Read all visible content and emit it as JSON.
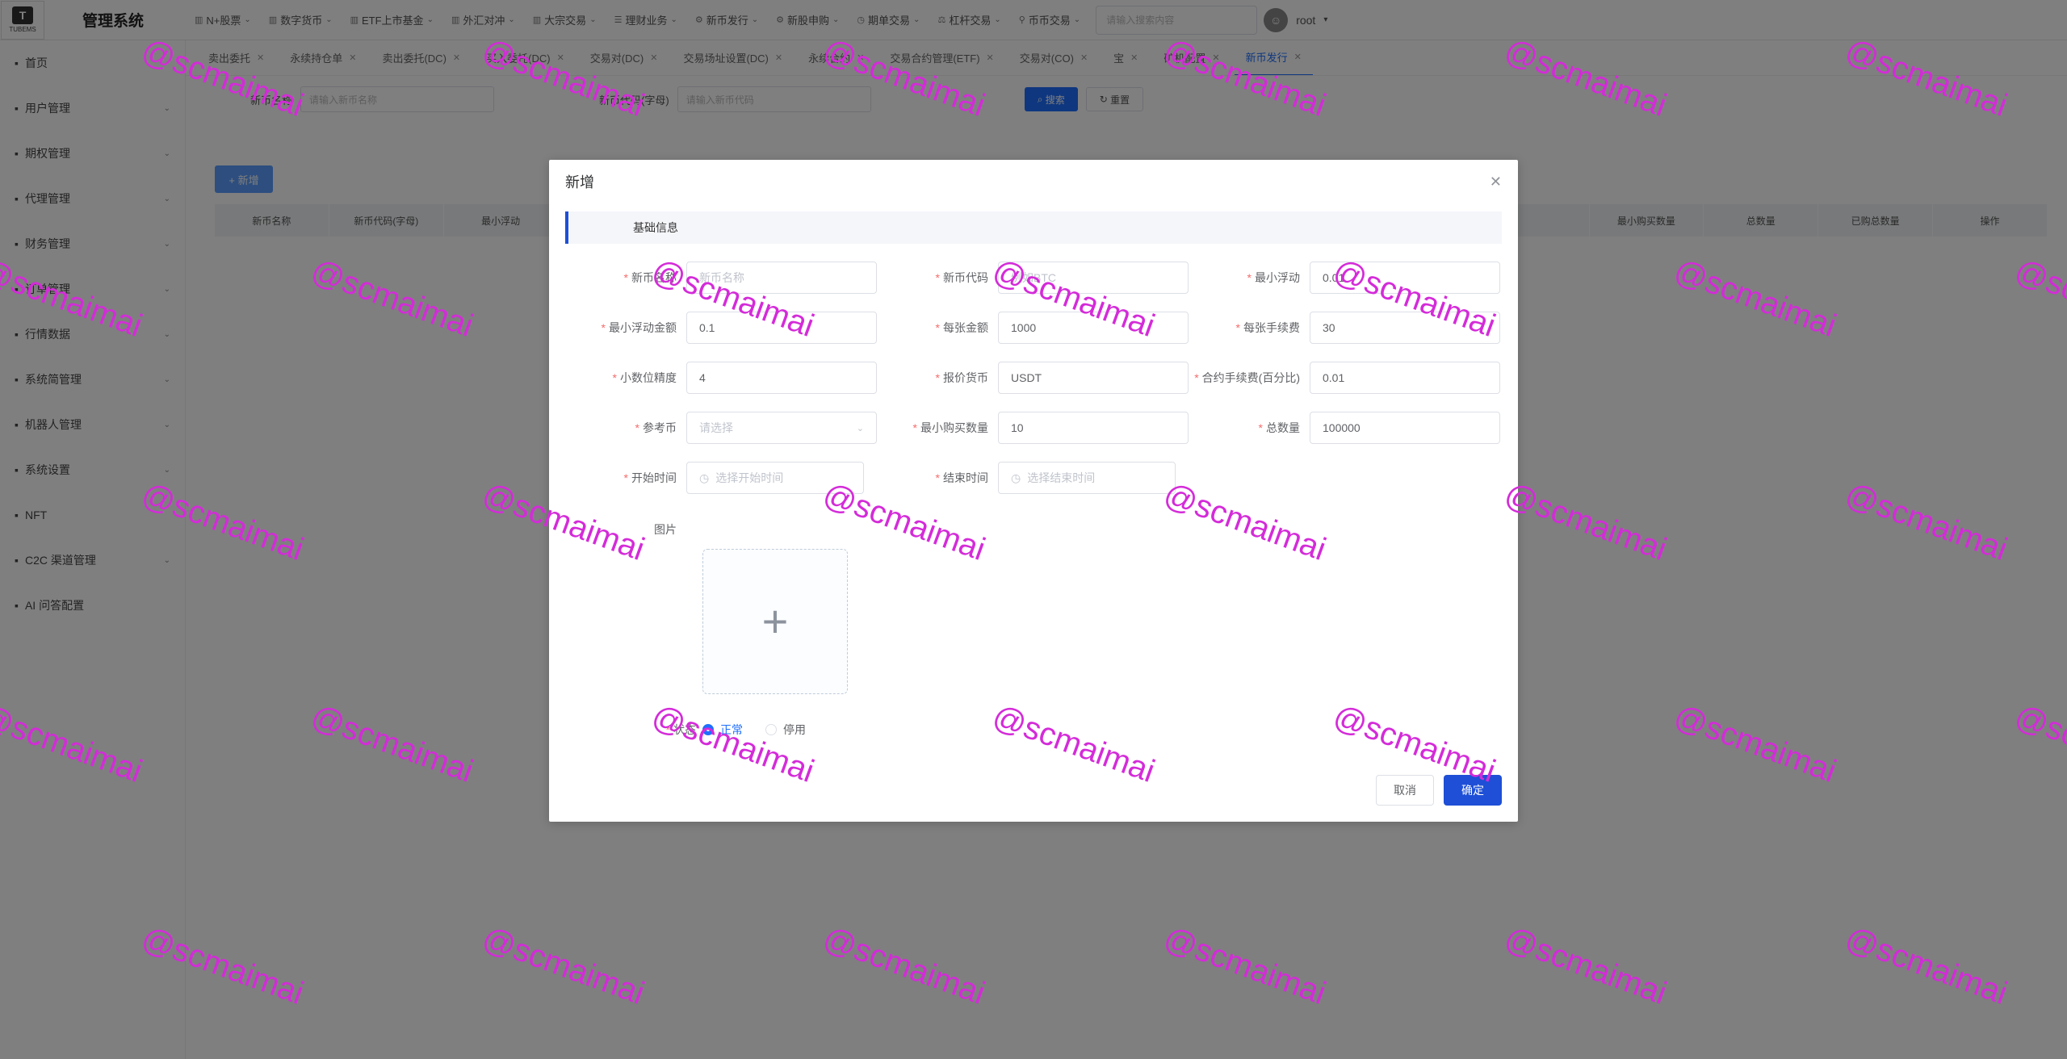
{
  "app": {
    "logo_text": "TUBEMS",
    "title": "管理系统"
  },
  "topnav": [
    {
      "label": "N+股票",
      "icon": "chart-icon"
    },
    {
      "label": "数字货币",
      "icon": "chart-icon"
    },
    {
      "label": "ETF上市基金",
      "icon": "chart-icon"
    },
    {
      "label": "外汇对冲",
      "icon": "chart-icon"
    },
    {
      "label": "大宗交易",
      "icon": "chart-icon"
    },
    {
      "label": "理财业务",
      "icon": "list-icon"
    },
    {
      "label": "新币发行",
      "icon": "gear-icon"
    },
    {
      "label": "新股申购",
      "icon": "gear-icon"
    },
    {
      "label": "期单交易",
      "icon": "clock-icon"
    },
    {
      "label": "杠杆交易",
      "icon": "lever-icon"
    },
    {
      "label": "币币交易",
      "icon": "pin-icon"
    }
  ],
  "top_search": {
    "placeholder": "请输入搜索内容"
  },
  "user": {
    "name": "root"
  },
  "sidebar": [
    {
      "label": "首页",
      "has_children": false
    },
    {
      "label": "用户管理",
      "has_children": true
    },
    {
      "label": "期权管理",
      "has_children": true
    },
    {
      "label": "代理管理",
      "has_children": true
    },
    {
      "label": "财务管理",
      "has_children": true
    },
    {
      "label": "订单管理",
      "has_children": true
    },
    {
      "label": "行情数据",
      "has_children": true
    },
    {
      "label": "系统简管理",
      "has_children": true
    },
    {
      "label": "机器人管理",
      "has_children": true
    },
    {
      "label": "系统设置",
      "has_children": true
    },
    {
      "label": "NFT",
      "has_children": false
    },
    {
      "label": "C2C 渠道管理",
      "has_children": true
    },
    {
      "label": "AI 问答配置",
      "has_children": false
    }
  ],
  "tabs": [
    {
      "label": "卖出委托",
      "active": false
    },
    {
      "label": "永续持仓单",
      "active": false
    },
    {
      "label": "卖出委托(DC)",
      "active": false
    },
    {
      "label": "买入委托(DC)",
      "active": false
    },
    {
      "label": "交易对(DC)",
      "active": false
    },
    {
      "label": "交易场址设置(DC)",
      "active": false
    },
    {
      "label": "永续合约",
      "active": false
    },
    {
      "label": "交易合约管理(ETF)",
      "active": false
    },
    {
      "label": "交易对(CO)",
      "active": false
    },
    {
      "label": "宝",
      "active": false
    },
    {
      "label": "矿机配置",
      "active": false
    },
    {
      "label": "新币发行",
      "active": true
    }
  ],
  "filter": {
    "name_label": "新币名称",
    "name_placeholder": "请输入新币名称",
    "code_label": "新币代码(字母)",
    "code_placeholder": "请输入新币代码",
    "search_label": "搜索",
    "reset_label": "重置"
  },
  "add_button": "+ 新增",
  "table_headers": [
    "新币名称",
    "新币代码(字母)",
    "最小浮动",
    "",
    "",
    "",
    "",
    "",
    "",
    "",
    "",
    "",
    "最小购买数量",
    "总数量",
    "已购总数量",
    "操作"
  ],
  "dialog": {
    "title": "新增",
    "section": "基础信息",
    "fields": {
      "coin_name": {
        "label": "新币名称",
        "value": "",
        "placeholder": "新币名称"
      },
      "coin_code": {
        "label": "新币代码",
        "value": "",
        "placeholder": "例如BTC"
      },
      "min_float": {
        "label": "最小浮动",
        "value": "0.01"
      },
      "min_float_amount": {
        "label": "最小浮动金额",
        "value": "0.1"
      },
      "per_amount": {
        "label": "每张金额",
        "value": "1000"
      },
      "per_fee": {
        "label": "每张手续费",
        "value": "30"
      },
      "decimal_precision": {
        "label": "小数位精度",
        "value": "4"
      },
      "quote_currency": {
        "label": "报价货币",
        "value": "USDT"
      },
      "contract_fee": {
        "label": "合约手续费(百分比)",
        "value": "0.01"
      },
      "reference_coin": {
        "label": "参考币",
        "value": "",
        "placeholder": "请选择"
      },
      "min_buy_qty": {
        "label": "最小购买数量",
        "value": "10"
      },
      "total_qty": {
        "label": "总数量",
        "value": "100000"
      },
      "start_time": {
        "label": "开始时间",
        "placeholder": "选择开始时间"
      },
      "end_time": {
        "label": "结束时间",
        "placeholder": "选择结束时间"
      }
    },
    "image_label": "图片",
    "status": {
      "label": "状态",
      "options": [
        {
          "label": "正常",
          "checked": true
        },
        {
          "label": "停用",
          "checked": false
        }
      ]
    },
    "cancel_label": "取消",
    "ok_label": "确定"
  },
  "watermark": "@scmaimai",
  "colors": {
    "primary": "#1e4fd6",
    "watermark": "#d42bd9",
    "required": "#f56c6c"
  }
}
